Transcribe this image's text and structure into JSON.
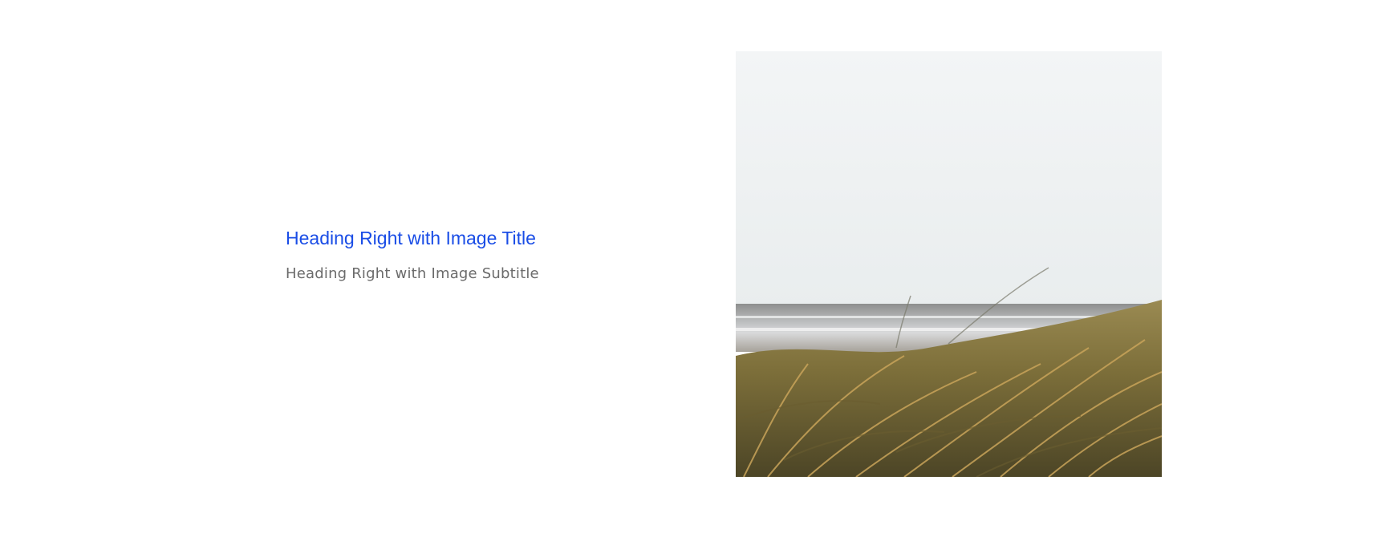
{
  "section": {
    "title": "Heading Right with Image Title",
    "subtitle": "Heading Right with Image Subtitle",
    "image": {
      "subject": "beach-dune-grass-photo"
    }
  },
  "colors": {
    "title": "#1a4de6",
    "subtitle": "#6b6b6b",
    "background": "#ffffff"
  }
}
